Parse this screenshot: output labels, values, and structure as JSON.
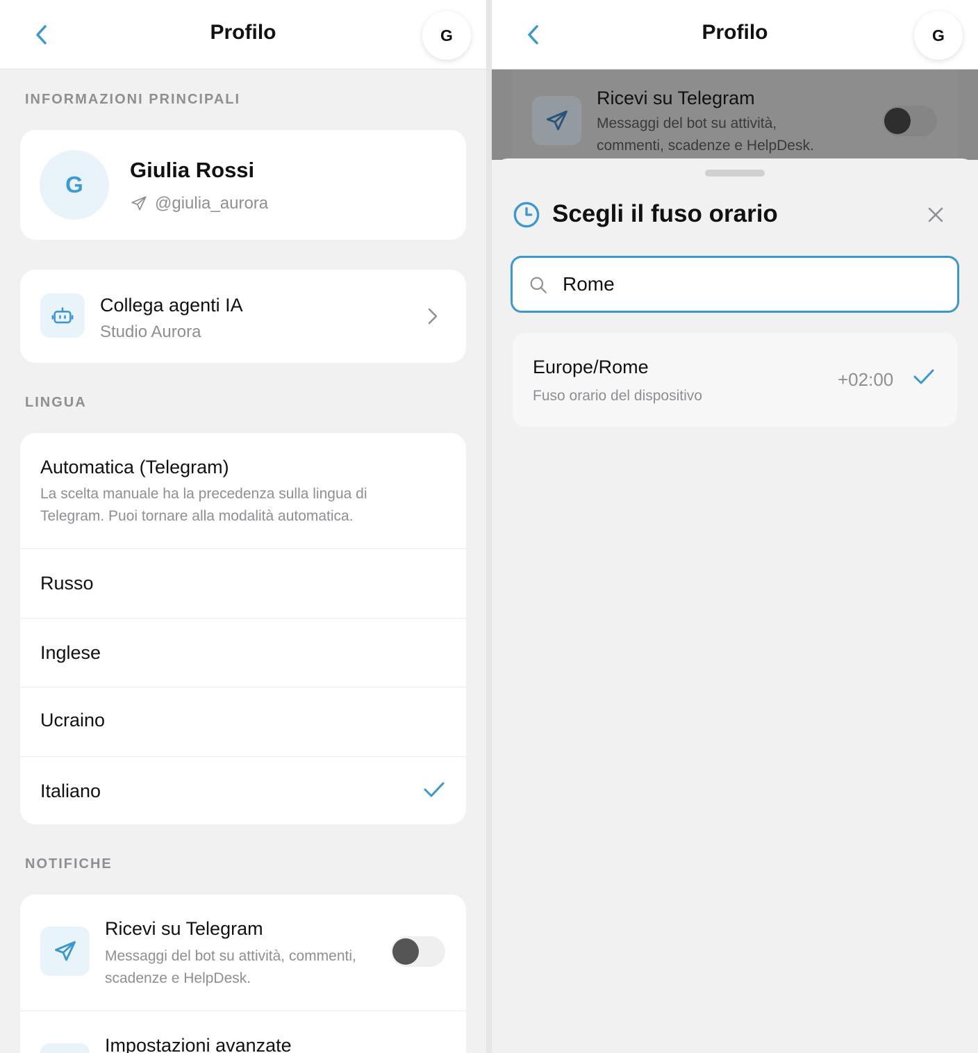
{
  "left": {
    "header": {
      "title": "Profilo",
      "avatar_initial": "G"
    },
    "sections": {
      "main": "INFORMAZIONI PRINCIPALI",
      "language": "LINGUA",
      "notifications": "NOTIFICHE"
    },
    "profile": {
      "initial": "G",
      "name": "Giulia Rossi",
      "handle": "@giulia_aurora"
    },
    "agents": {
      "title": "Collega agenti IA",
      "subtitle": "Studio Aurora"
    },
    "language": {
      "auto_title": "Automatica (Telegram)",
      "auto_sub": "La scelta manuale ha la precedenza sulla lingua di Telegram. Puoi tornare alla modalità automatica.",
      "options": [
        "Russo",
        "Inglese",
        "Ucraino",
        "Italiano"
      ],
      "selected": "Italiano"
    },
    "notifications": {
      "telegram_title": "Ricevi su Telegram",
      "telegram_sub": "Messaggi del bot su attività, commenti, scadenze e HelpDesk.",
      "telegram_enabled": false,
      "advanced_title": "Impostazioni avanzate"
    }
  },
  "right": {
    "header": {
      "title": "Profilo",
      "avatar_initial": "G"
    },
    "background_row": {
      "title": "Ricevi su Telegram",
      "sub_line1": "Messaggi del bot su attività,",
      "sub_line2": "commenti, scadenze e HelpDesk."
    },
    "sheet": {
      "title": "Scegli il fuso orario",
      "search_value": "Rome",
      "results": [
        {
          "name": "Europe/Rome",
          "subtitle": "Fuso orario del dispositivo",
          "offset": "+02:00",
          "selected": true
        }
      ]
    }
  },
  "colors": {
    "accent": "#3a97d2",
    "muted": "#8e8e93",
    "background": "#f1f1f1",
    "card": "#ffffff"
  }
}
